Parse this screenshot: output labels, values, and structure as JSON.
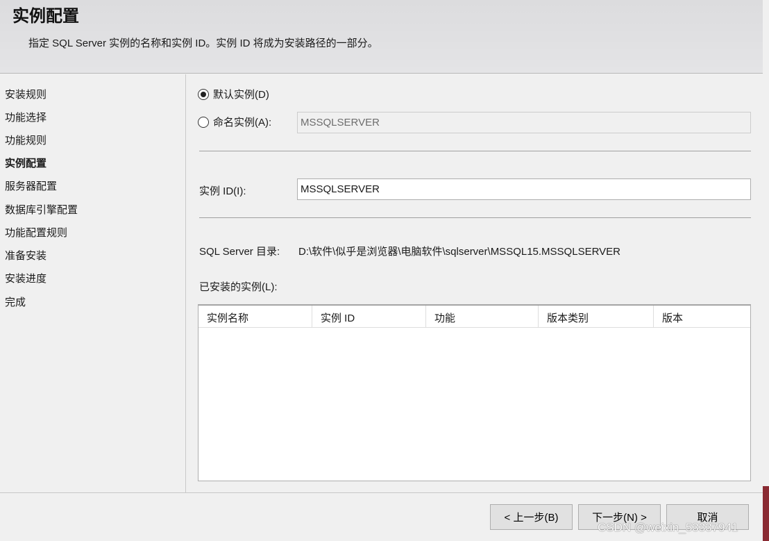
{
  "header": {
    "title": "实例配置",
    "subtitle": "指定 SQL Server 实例的名称和实例 ID。实例 ID 将成为安装路径的一部分。"
  },
  "sidebar": {
    "items": [
      "安装规则",
      "功能选择",
      "功能规则",
      "实例配置",
      "服务器配置",
      "数据库引擎配置",
      "功能配置规则",
      "准备安装",
      "安装进度",
      "完成"
    ],
    "active_index": 3
  },
  "main": {
    "default_instance_label": "默认实例(D)",
    "named_instance_label": "命名实例(A):",
    "named_instance_value": "MSSQLSERVER",
    "instance_id_label": "实例 ID(I):",
    "instance_id_value": "MSSQLSERVER",
    "dir_label": "SQL Server 目录:",
    "dir_value": "D:\\软件\\似乎是浏览器\\电脑软件\\sqlserver\\MSSQL15.MSSQLSERVER",
    "installed_label": "已安装的实例(L):",
    "columns": [
      "实例名称",
      "实例 ID",
      "功能",
      "版本类别",
      "版本"
    ]
  },
  "footer": {
    "back": "< 上一步(B)",
    "next": "下一步(N) >",
    "cancel": "取消"
  },
  "watermark": "CSDN @weixin_53337941"
}
